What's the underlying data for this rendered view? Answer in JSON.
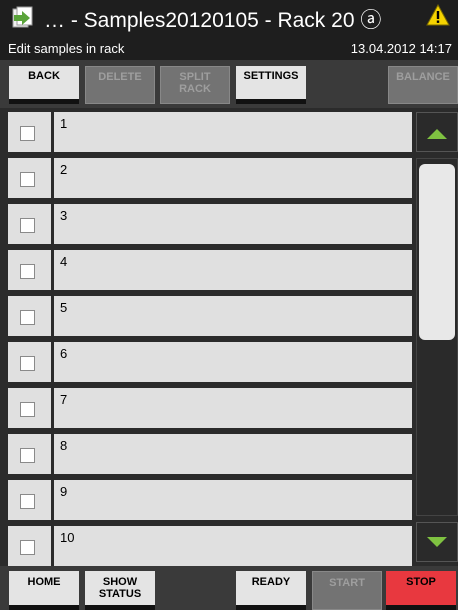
{
  "header": {
    "title": "… - Samples20120105 - Rack 20 ⓐ",
    "subtitle": "Edit samples in rack",
    "datetime": "13.04.2012 14:17"
  },
  "toolbar": {
    "back": "BACK",
    "delete": "DELETE",
    "split_rack_1": "SPLIT",
    "split_rack_2": "RACK",
    "settings": "SETTINGS",
    "balance": "BALANCE"
  },
  "list": {
    "rows": [
      "1",
      "2",
      "3",
      "4",
      "5",
      "6",
      "7",
      "8",
      "9",
      "10"
    ]
  },
  "bottombar": {
    "home": "HOME",
    "show_status_1": "SHOW",
    "show_status_2": "STATUS",
    "ready": "READY",
    "start": "START",
    "stop": "STOP"
  },
  "icons": {
    "app": "samples-app-icon",
    "warning": "warning-icon",
    "scroll_up": "triangle-up-icon",
    "scroll_down": "triangle-down-icon"
  },
  "colors": {
    "accent_green": "#7fc241",
    "stop_red": "#e8383f",
    "warning_yellow": "#f5d300"
  }
}
